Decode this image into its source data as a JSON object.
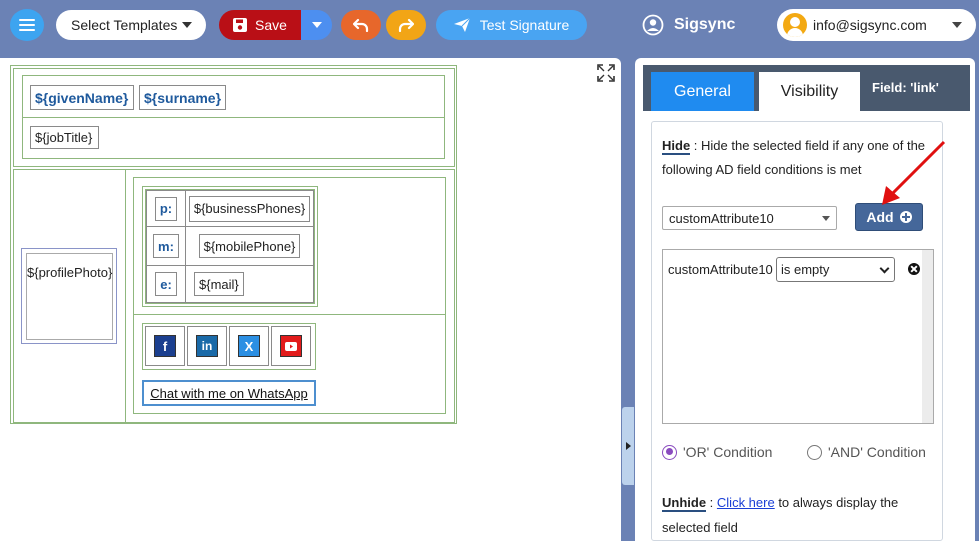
{
  "toolbar": {
    "templates_label": "Select Templates",
    "save_label": "Save",
    "test_label": "Test Signature",
    "brand": "Sigsync",
    "user_email": "info@sigsync.com"
  },
  "signature": {
    "given_name": "${givenName}",
    "surname": "${surname}",
    "job_title": "${jobTitle}",
    "profile_photo": "${profilePhoto}",
    "contacts": [
      {
        "label": "p:",
        "value": "${businessPhones}"
      },
      {
        "label": "m:",
        "value": "${mobilePhone}"
      },
      {
        "label": "e:",
        "value": "${mail}"
      }
    ],
    "social_icons": [
      "facebook-icon",
      "linkedin-icon",
      "x-twitter-icon",
      "youtube-icon"
    ],
    "whatsapp_label": "Chat with me on WhatsApp"
  },
  "panel": {
    "tabs": [
      "General",
      "Visibility"
    ],
    "field_tag_prefix": "Field: ",
    "field_tag_value": "'link'",
    "hide_title": "Hide",
    "hide_desc": " : Hide the selected field if any one of the following AD field conditions is met",
    "attribute_selected": "customAttribute10",
    "add_label": "Add",
    "condition": {
      "field": "customAttribute10",
      "operator": "is empty"
    },
    "or_label": "'OR' Condition",
    "and_label": "'AND' Condition",
    "unhide_title": "Unhide",
    "unhide_pre": " : ",
    "unhide_link": "Click here",
    "unhide_post": " to always display the selected field"
  },
  "colors": {
    "facebook": "#1b3f8f",
    "linkedin": "#1a6aa8",
    "x": "#2b8fe3",
    "youtube": "#e21b1b",
    "accent": "#1f8bf0"
  }
}
